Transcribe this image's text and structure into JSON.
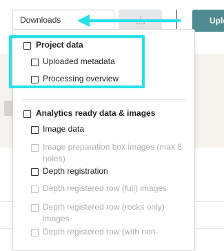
{
  "toolbar": {
    "downloads_label": "Downloads",
    "upload_label": "Upload",
    "download_icon": "download-tray-icon"
  },
  "annotation": {
    "arrow_color": "#27e0e8",
    "highlight_color": "#27e0e8"
  },
  "dropdown": {
    "items": [
      {
        "label": "Project data",
        "bold": true,
        "enabled": true
      },
      {
        "label": "Uploaded metadata",
        "bold": false,
        "enabled": true
      },
      {
        "label": "Processing overview",
        "bold": false,
        "enabled": true
      },
      {
        "label": "Analytics ready data & images",
        "bold": true,
        "enabled": true
      },
      {
        "label": "Image data",
        "bold": false,
        "enabled": true
      },
      {
        "label": "Image preparation box images (max 8 holes)",
        "bold": false,
        "enabled": false
      },
      {
        "label": "Depth registration",
        "bold": false,
        "enabled": true
      },
      {
        "label": "Depth registered row (full) images",
        "bold": false,
        "enabled": false
      },
      {
        "label": "Depth registered row (rocks only) images",
        "bold": false,
        "enabled": false
      },
      {
        "label": "Depth registered row (with non-",
        "bold": false,
        "enabled": false
      }
    ]
  },
  "colors": {
    "upload_button": "#4f8b90",
    "download_button_bg": "#e4e6e7",
    "page_band": "#f6f2ee"
  }
}
